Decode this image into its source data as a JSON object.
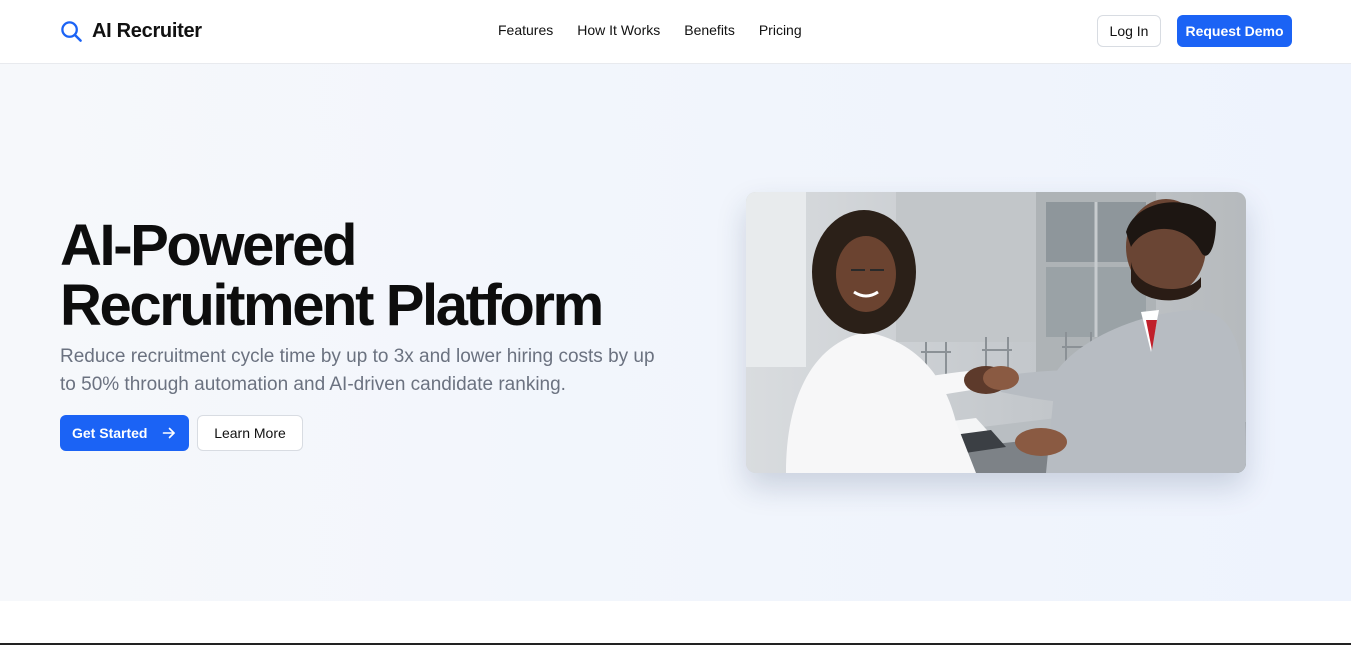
{
  "brand": {
    "name": "AI Recruiter",
    "icon": "search-icon",
    "accent": "#1b63f5"
  },
  "nav": {
    "items": [
      {
        "label": "Features"
      },
      {
        "label": "How It Works"
      },
      {
        "label": "Benefits"
      },
      {
        "label": "Pricing"
      }
    ]
  },
  "header": {
    "login_label": "Log In",
    "demo_label": "Request Demo"
  },
  "hero": {
    "title_line1": "AI-Powered",
    "title_line2": "Recruitment Platform",
    "subtitle": "Reduce recruitment cycle time by up to 3x and lower hiring costs by up to 50% through automation and AI-driven candidate ranking.",
    "primary_label": "Get Started",
    "primary_icon": "arrow-right-icon",
    "secondary_label": "Learn More",
    "image_alt": "handshake-photo"
  }
}
